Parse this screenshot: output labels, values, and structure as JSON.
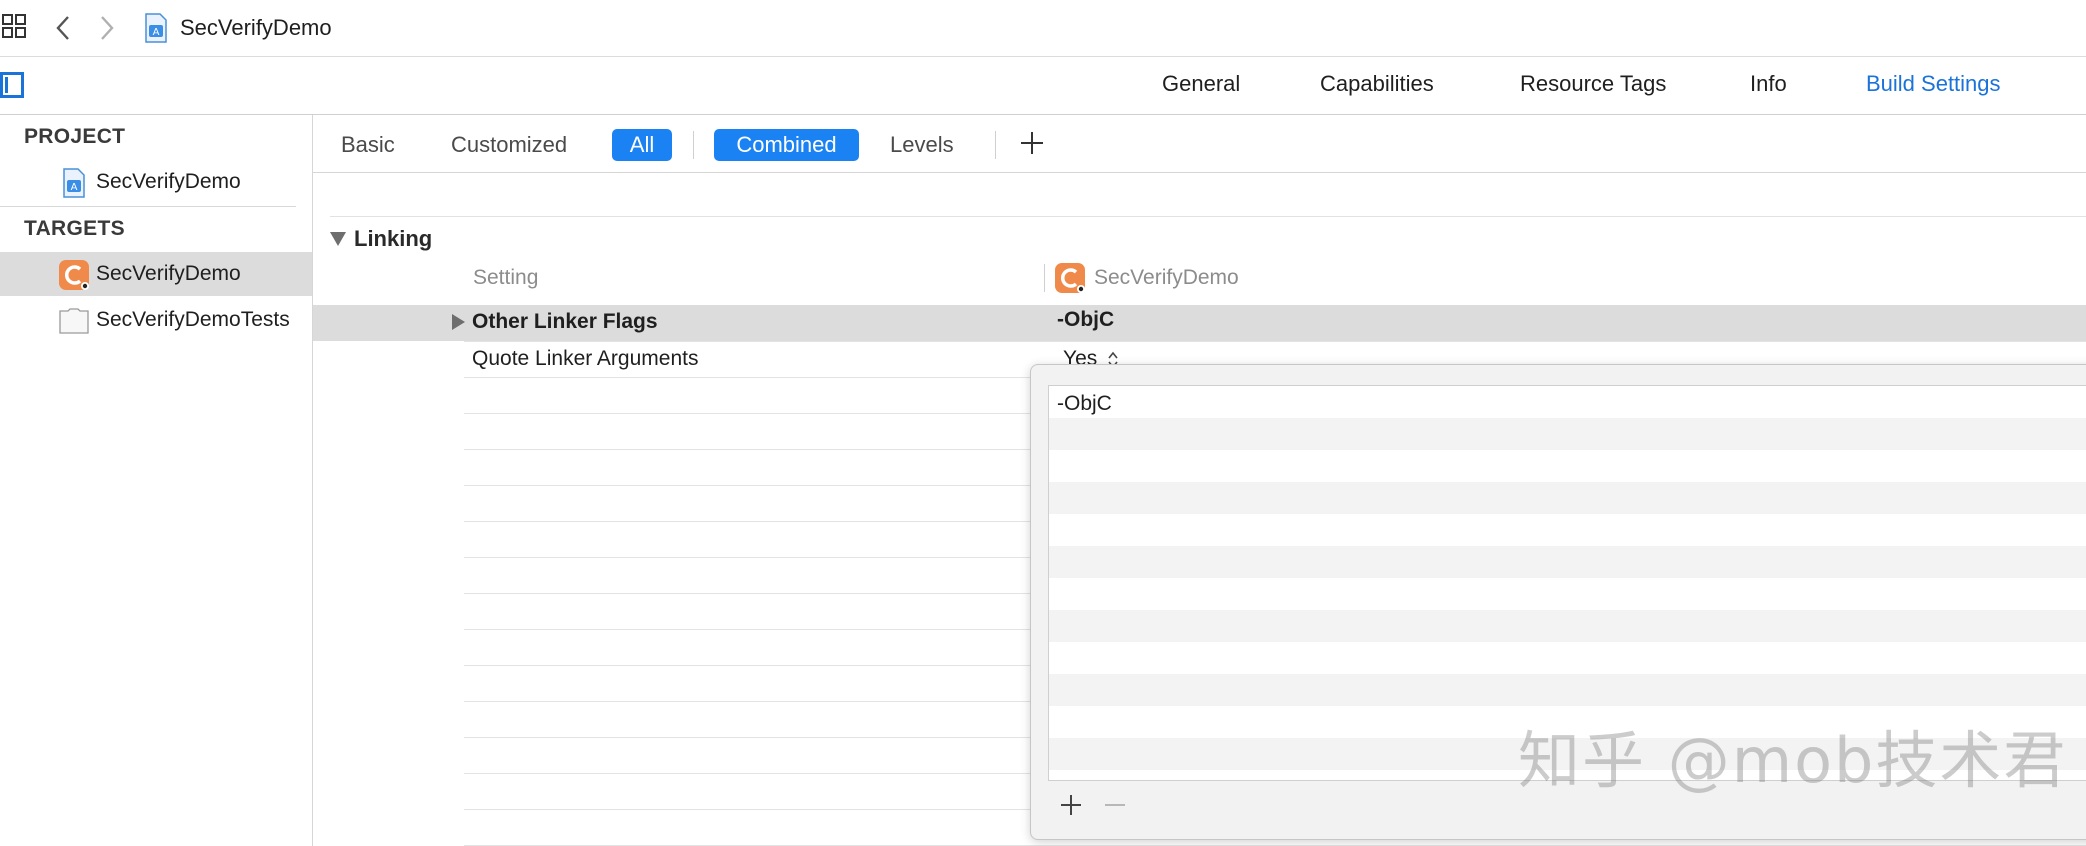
{
  "window": {
    "breadcrumb_title": "SecVerifyDemo"
  },
  "project_tabs": [
    {
      "label": "General"
    },
    {
      "label": "Capabilities"
    },
    {
      "label": "Resource Tags"
    },
    {
      "label": "Info"
    },
    {
      "label": "Build Settings",
      "active": true
    }
  ],
  "sidebar": {
    "project_header": "PROJECT",
    "project_item": "SecVerifyDemo",
    "targets_header": "TARGETS",
    "targets": [
      {
        "label": "SecVerifyDemo",
        "selected": true
      },
      {
        "label": "SecVerifyDemoTests",
        "selected": false
      }
    ]
  },
  "filters": {
    "basic": "Basic",
    "customized": "Customized",
    "all": "All",
    "combined": "Combined",
    "levels": "Levels"
  },
  "section": {
    "title": "Linking",
    "col_setting": "Setting",
    "col_target": "SecVerifyDemo",
    "rows": [
      {
        "name": "Other Linker Flags",
        "value": "-ObjC"
      },
      {
        "name": "Quote Linker Arguments",
        "value": "Yes"
      }
    ]
  },
  "popover": {
    "values": [
      "-ObjC"
    ]
  },
  "watermark": "知乎 @mob技术君",
  "colors": {
    "accent": "#1a73d9",
    "selected_button": "#1a82f2",
    "selection_gray": "#dcdcdc"
  }
}
